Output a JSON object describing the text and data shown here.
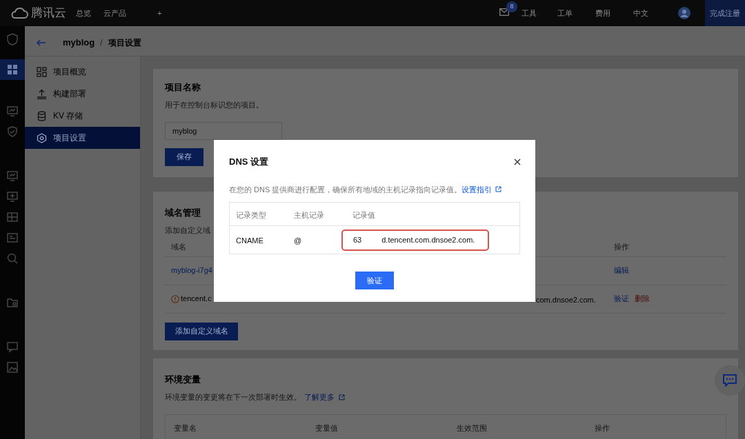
{
  "top_bar": {
    "logo": "腾讯云",
    "nav": [
      "总览",
      "云产品",
      "+"
    ],
    "mail_badge": "8",
    "links": [
      "工具",
      "工单",
      "费用",
      "中文"
    ],
    "register_button": "完成注册"
  },
  "rail": [
    {
      "kind": "shield",
      "selected": false
    },
    {
      "kind": "grid",
      "selected": true
    },
    {
      "kind": "monitor",
      "selected": false
    },
    {
      "kind": "shield-check",
      "selected": false
    },
    {
      "kind": "monitor",
      "selected": false
    },
    {
      "kind": "monitor-plus",
      "selected": false
    },
    {
      "kind": "table",
      "selected": false
    },
    {
      "kind": "panel",
      "selected": false
    },
    {
      "kind": "search",
      "selected": false
    },
    {
      "kind": "folder",
      "selected": false
    },
    {
      "kind": "chat",
      "selected": false
    },
    {
      "kind": "image",
      "selected": false
    }
  ],
  "breadcrumb": {
    "project": "myblog",
    "separator": "/",
    "page": "项目设置"
  },
  "nav": [
    {
      "kind": "overview",
      "label": "项目概览",
      "selected": false
    },
    {
      "kind": "upload",
      "label": "构建部署",
      "selected": false
    },
    {
      "kind": "database",
      "label": "KV 存储",
      "selected": false
    },
    {
      "kind": "settings",
      "label": "项目设置",
      "selected": true
    }
  ],
  "project_name": {
    "title": "项目名称",
    "subtitle": "用于在控制台标识您的项目。",
    "value": "myblog",
    "save_button": "保存"
  },
  "domains": {
    "title": "域名管理",
    "subtitle": "添加自定义域",
    "columns": [
      "域名",
      "操作"
    ],
    "rows": [
      {
        "domain": "myblog-i7g4",
        "warning": false,
        "record": "",
        "actions": [
          {
            "label": "编辑",
            "kind": "link"
          }
        ]
      },
      {
        "domain": "tencent.c",
        "warning": true,
        "record": "com.dnsoe2.com.",
        "actions": [
          {
            "label": "验证",
            "kind": "link"
          },
          {
            "label": "删除",
            "kind": "danger"
          }
        ]
      }
    ],
    "add_button": "添加自定义域名"
  },
  "env": {
    "title": "环境变量",
    "subtitle": "环境变量的变更将在下一次部署时生效。",
    "link": "了解更多",
    "columns": [
      "变量名",
      "变量值",
      "生效范围",
      "操作"
    ]
  },
  "modal": {
    "title": "DNS 设置",
    "description": "在您的 DNS 提供商进行配置，确保所有地域的主机记录指向记录值。",
    "link": "设置指引",
    "columns": [
      "记录类型",
      "主机记录",
      "记录值"
    ],
    "row": {
      "type": "CNAME",
      "host": "@",
      "value_start": "63",
      "value_end": "d.tencent.com.dnsoe2.com.",
      "highlighted": true
    },
    "verify_button": "验证"
  }
}
